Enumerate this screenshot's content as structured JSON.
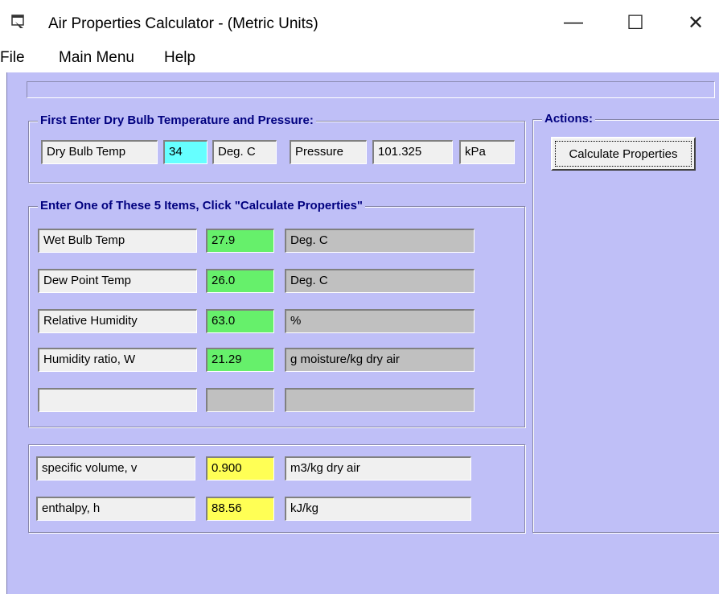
{
  "window": {
    "title": "Air Properties Calculator - (Metric Units)",
    "minimize": "—",
    "maximize": "☐",
    "close": "✕"
  },
  "menu": [
    "File",
    "Main Menu",
    "Help"
  ],
  "first_group": {
    "legend": "First Enter Dry Bulb Temperature and Pressure:",
    "dry_bulb_label": "Dry Bulb Temp",
    "dry_bulb_value": "34",
    "dry_bulb_unit": "Deg. C",
    "pressure_label": "Pressure",
    "pressure_value": "101.325",
    "pressure_unit": "kPa"
  },
  "second_group": {
    "legend": "Enter One of These 5 Items, Click \"Calculate Properties\"",
    "rows": [
      {
        "label": "Wet Bulb Temp",
        "value": "27.9",
        "unit": "Deg. C"
      },
      {
        "label": "Dew Point Temp",
        "value": "26.0",
        "unit": "Deg. C"
      },
      {
        "label": "Relative Humidity",
        "value": "63.0",
        "unit": "%"
      },
      {
        "label": "Humidity ratio, W",
        "value": "21.29",
        "unit": "g moisture/kg dry air"
      },
      {
        "label": "",
        "value": "",
        "unit": ""
      }
    ]
  },
  "results": {
    "rows": [
      {
        "label": "specific volume, v",
        "value": "0.900",
        "unit": "m3/kg dry air"
      },
      {
        "label": "enthalpy, h",
        "value": "88.56",
        "unit": "kJ/kg"
      }
    ]
  },
  "actions": {
    "legend": "Actions:",
    "calculate_button": "Calculate Properties"
  }
}
